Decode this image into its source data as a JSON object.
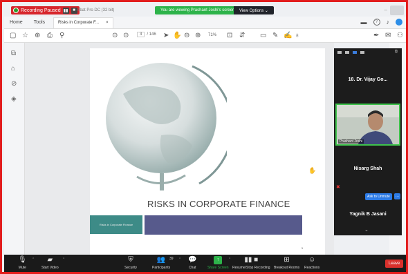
{
  "recording": {
    "label": "Recording Paused",
    "pause_icon": "pause-icon",
    "stop_icon": "stop-icon"
  },
  "file_hint": "obat Pro DC (32 bit)",
  "share": {
    "banner": "You are viewing Prashant Joshi's screen",
    "view_options": "View Options ⌄"
  },
  "window": {
    "minimize": "–",
    "button": ""
  },
  "tabs": {
    "home": "Home",
    "tools": "Tools",
    "doc": "Risks in Corporate F...",
    "close": "×"
  },
  "toolbar": {
    "page_current": "3",
    "page_total": "/ 146",
    "zoom": "71%"
  },
  "slide": {
    "title": "RISKS IN CORPORATE FINANCE",
    "teal_caption": "Risks in Corporate Finance",
    "page_number": "3"
  },
  "panel": {
    "tiles": [
      {
        "name": "18. Dr. Vijay Go..."
      },
      {
        "name": "Prashant Joshi"
      },
      {
        "name": "Nisarg Shah"
      },
      {
        "name": "Yagnik B Jasani"
      }
    ],
    "ask_unmute": "Ask to Unmute",
    "more": "···"
  },
  "meeting_bar": {
    "mute": "Mute",
    "start_video": "Start Video",
    "security": "Security",
    "participants": "Participants",
    "participant_count": "39",
    "chat": "Chat",
    "share_screen": "Share Screen",
    "recording": "Resume/Stop Recording",
    "breakout": "Breakout Rooms",
    "reactions": "Reactions",
    "leave": "Leave"
  },
  "colors": {
    "frame": "#e21d1d",
    "share_green": "#2db34a",
    "leave_red": "#d9302c",
    "ask_blue": "#2d7be6"
  }
}
